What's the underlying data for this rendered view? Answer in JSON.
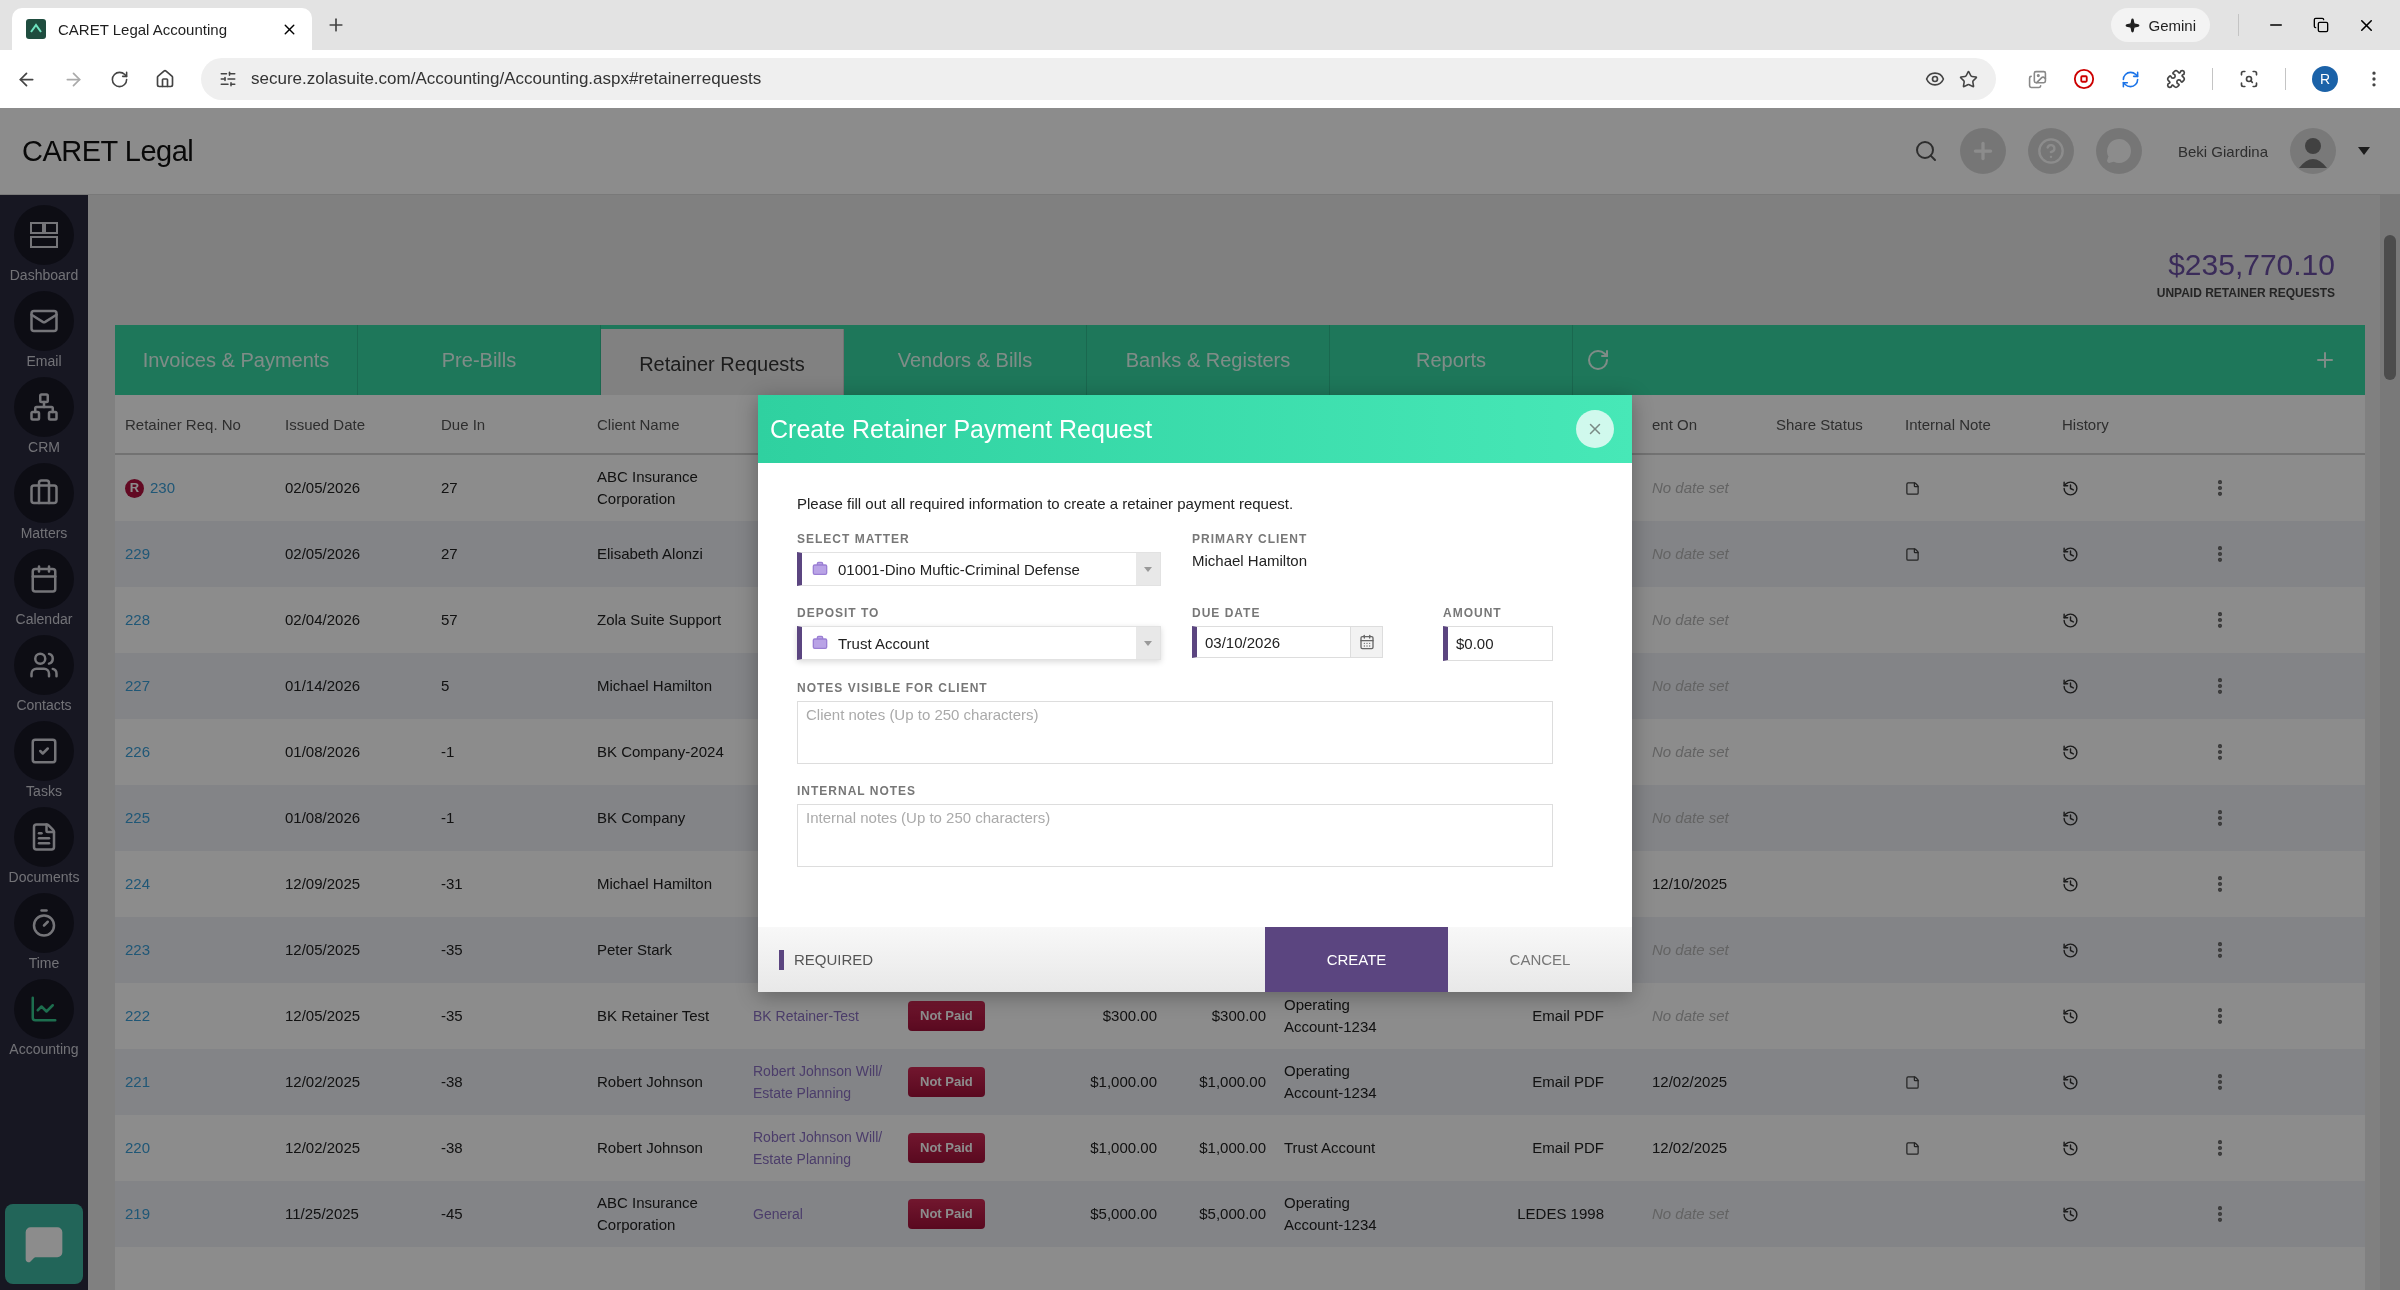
{
  "browser": {
    "tab_title": "CARET Legal Accounting",
    "url": "secure.zolasuite.com/Accounting/Accounting.aspx#retainerrequests",
    "gemini": "Gemini",
    "profile_initial": "R"
  },
  "app": {
    "logo": "CARET Legal",
    "user": "Beki Giardina"
  },
  "sidebar": [
    {
      "label": "Dashboard",
      "selected": false
    },
    {
      "label": "Email",
      "selected": false
    },
    {
      "label": "CRM",
      "selected": false
    },
    {
      "label": "Matters",
      "selected": false
    },
    {
      "label": "Calendar",
      "selected": false
    },
    {
      "label": "Contacts",
      "selected": false
    },
    {
      "label": "Tasks",
      "selected": false
    },
    {
      "label": "Documents",
      "selected": false
    },
    {
      "label": "Time",
      "selected": false
    },
    {
      "label": "Accounting",
      "selected": true
    }
  ],
  "summary": {
    "amount": "$235,770.10",
    "label": "UNPAID RETAINER REQUESTS"
  },
  "tabs": [
    {
      "label": "Invoices & Payments",
      "selected": false
    },
    {
      "label": "Pre-Bills",
      "selected": false
    },
    {
      "label": "Retainer Requests",
      "selected": true
    },
    {
      "label": "Vendors & Bills",
      "selected": false
    },
    {
      "label": "Banks & Registers",
      "selected": false
    },
    {
      "label": "Reports",
      "selected": false
    }
  ],
  "table": {
    "columns": [
      "Retainer Req. No",
      "Issued Date",
      "Due In",
      "Client Name",
      "ent On",
      "Share Status",
      "Internal Note",
      "History"
    ],
    "rows": [
      {
        "number": "230",
        "badge": "R",
        "issued": "02/05/2026",
        "due_in": "27",
        "client": "ABC Insurance Corporation",
        "sent_on": "No date set",
        "sent_on_set": false,
        "internal_note": true
      },
      {
        "number": "229",
        "issued": "02/05/2026",
        "due_in": "27",
        "client": "Elisabeth Alonzi",
        "sent_on": "No date set",
        "sent_on_set": false,
        "internal_note": true
      },
      {
        "number": "228",
        "issued": "02/04/2026",
        "due_in": "57",
        "client": "Zola Suite Support",
        "sent_on": "No date set",
        "sent_on_set": false,
        "internal_note": false
      },
      {
        "number": "227",
        "issued": "01/14/2026",
        "due_in": "5",
        "client": "Michael Hamilton",
        "sent_on": "No date set",
        "sent_on_set": false,
        "internal_note": false
      },
      {
        "number": "226",
        "issued": "01/08/2026",
        "due_in": "-1",
        "client": "BK Company-2024",
        "sent_on": "No date set",
        "sent_on_set": false,
        "internal_note": false
      },
      {
        "number": "225",
        "issued": "01/08/2026",
        "due_in": "-1",
        "client": "BK Company",
        "sent_on": "No date set",
        "sent_on_set": false,
        "internal_note": false
      },
      {
        "number": "224",
        "issued": "12/09/2025",
        "due_in": "-31",
        "client": "Michael Hamilton",
        "sent_on": "12/10/2025",
        "sent_on_set": true,
        "internal_note": false
      },
      {
        "number": "223",
        "issued": "12/05/2025",
        "due_in": "-35",
        "client": "Peter Stark",
        "sent_on": "No date set",
        "sent_on_set": false,
        "internal_note": false
      },
      {
        "number": "222",
        "issued": "12/05/2025",
        "due_in": "-35",
        "client": "BK Retainer Test",
        "column_5": "BK Retainer-Test",
        "column_6": "Not Paid",
        "column_7": "$300.00",
        "column_8": "$300.00",
        "column_9": "Operating Account-1234",
        "column_10": "Email PDF",
        "sent_on": "No date set",
        "sent_on_set": false,
        "internal_note": false
      },
      {
        "number": "221",
        "issued": "12/02/2025",
        "due_in": "-38",
        "client": "Robert Johnson",
        "column_5": "Robert Johnson Will/ Estate Planning",
        "column_6": "Not Paid",
        "column_7": "$1,000.00",
        "column_8": "$1,000.00",
        "column_9": "Operating Account-1234",
        "column_10": "Email PDF",
        "sent_on": "12/02/2025",
        "sent_on_set": true,
        "internal_note": true
      },
      {
        "number": "220",
        "issued": "12/02/2025",
        "due_in": "-38",
        "client": "Robert Johnson",
        "column_5": "Robert Johnson Will/ Estate Planning",
        "column_6": "Not Paid",
        "column_7": "$1,000.00",
        "column_8": "$1,000.00",
        "column_9": "Trust Account",
        "column_10": "Email PDF",
        "sent_on": "12/02/2025",
        "sent_on_set": true,
        "internal_note": true
      },
      {
        "number": "219",
        "issued": "11/25/2025",
        "due_in": "-45",
        "client": "ABC Insurance Corporation",
        "column_5": "General",
        "column_6": "Not Paid",
        "column_7": "$5,000.00",
        "column_8": "$5,000.00",
        "column_9": "Operating Account-1234",
        "column_10": "LEDES 1998",
        "sent_on": "No date set",
        "sent_on_set": false,
        "internal_note": false
      }
    ]
  },
  "modal": {
    "title": "Create Retainer Payment Request",
    "intro": "Please fill out all required information to create a retainer payment request.",
    "matter": {
      "label": "SELECT MATTER",
      "value": "01001-Dino Muftic-Criminal Defense",
      "required": true
    },
    "primary_client": {
      "label": "PRIMARY CLIENT",
      "value": "Michael Hamilton"
    },
    "deposit_to": {
      "label": "DEPOSIT TO",
      "value": "Trust Account",
      "required": true
    },
    "due_date": {
      "label": "DUE DATE",
      "value": "03/10/2026",
      "required": true
    },
    "amount": {
      "label": "AMOUNT",
      "value": "$0.00",
      "required": true
    },
    "client_notes": {
      "label": "NOTES VISIBLE FOR CLIENT",
      "placeholder": "Client notes (Up to 250 characters)"
    },
    "internal_notes": {
      "label": "INTERNAL NOTES",
      "placeholder": "Internal notes (Up to 250 characters)"
    },
    "required_legend": "REQUIRED",
    "buttons": [
      {
        "label": "CREATE",
        "kind": "primary"
      },
      {
        "label": "CANCEL",
        "kind": "secondary"
      }
    ]
  }
}
